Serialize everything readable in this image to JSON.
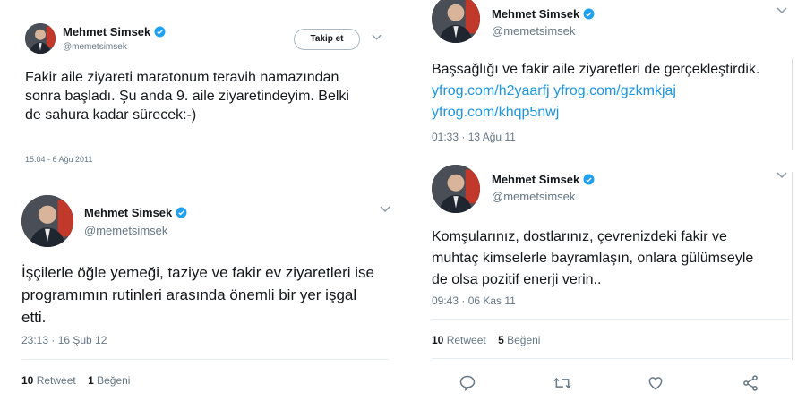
{
  "tweets": [
    {
      "name": "Mehmet Simsek",
      "handle": "@memetsimsek",
      "follow_label": "Takip et",
      "text": "Fakir aile ziyareti maratonum teravih namazından sonra başladı. Şu anda 9. aile ziyaretindeyim. Belki de sahura kadar sürecek:-)",
      "timestamp": "15:04 - 6 Ağu 2011"
    },
    {
      "name": "Mehmet Simsek",
      "handle": "@memetsimsek",
      "text": "İşçilerle öğle yemeği, taziye ve fakir ev ziyaretleri ise programımın rutinleri arasında önemli bir yer işgal etti.",
      "timestamp": "23:13 · 16 Şub 12",
      "retweets": "10",
      "retweets_label": "Retweet",
      "likes": "1",
      "likes_label": "Beğeni"
    },
    {
      "name": "Mehmet Simsek",
      "handle": "@memetsimsek",
      "text": "Başsağlığı  ve fakir aile ziyaretleri de gerçekleştirdik. ",
      "links": [
        "yfrog.com/h2yaarfj",
        "yfrog.com/gzkmkjaj",
        "yfrog.com/khqp5nwj"
      ],
      "timestamp": "01:33 · 13 Ağu 11"
    },
    {
      "name": "Mehmet Simsek",
      "handle": "@memetsimsek",
      "text": "Komşularınız, dostlarınız, çevrenizdeki fakir ve muhtaç kimselerle bayramlaşın, onlara gülümseyle de olsa pozitif enerji verin..",
      "timestamp": "09:43 · 06 Kas 11",
      "retweets": "10",
      "retweets_label": "Retweet",
      "likes": "5",
      "likes_label": "Beğeni"
    }
  ],
  "colors": {
    "verified": "#1da1f2",
    "link": "#1b95e0",
    "muted": "#657786"
  },
  "icons": [
    "verified-badge-icon",
    "chevron-down-icon",
    "reply-icon",
    "retweet-icon",
    "like-icon",
    "share-icon"
  ]
}
